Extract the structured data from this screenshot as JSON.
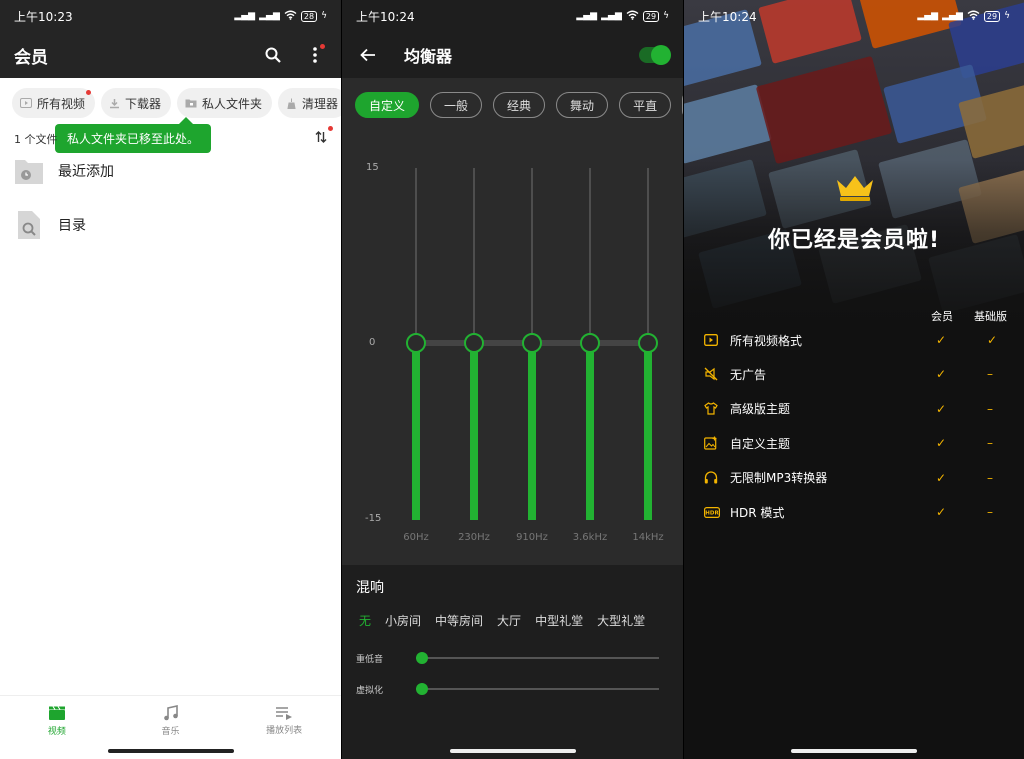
{
  "left": {
    "status": {
      "time": "上午10:23",
      "battery": "28"
    },
    "title": "会员",
    "chips": [
      "所有视频",
      "下载器",
      "私人文件夹",
      "清理器"
    ],
    "tooltip": "私人文件夹已移至此处。",
    "file_count": "1 个文件",
    "rows": [
      "最近添加",
      "目录"
    ],
    "nav": [
      "视频",
      "音乐",
      "播放列表"
    ],
    "accent": "#1ea52e"
  },
  "middle": {
    "status": {
      "time": "上午10:24",
      "battery": "29"
    },
    "title": "均衡器",
    "toggle_on": true,
    "presets": [
      "自定义",
      "一般",
      "经典",
      "舞动",
      "平直"
    ],
    "y_ticks": [
      "15",
      "0",
      "-15"
    ],
    "chart_data": {
      "type": "bar",
      "categories": [
        "60Hz",
        "230Hz",
        "910Hz",
        "3.6kHz",
        "14kHz"
      ],
      "values": [
        0,
        0,
        0,
        0,
        0
      ],
      "ylim": [
        -15,
        15
      ]
    },
    "reverb": {
      "title": "混响",
      "options": [
        "无",
        "小房间",
        "中等房间",
        "大厅",
        "中型礼堂",
        "大型礼堂"
      ],
      "selected": "无",
      "sliders": [
        {
          "label": "重低音",
          "value": 0
        },
        {
          "label": "虚拟化",
          "value": 0
        }
      ]
    },
    "accent": "#22b232"
  },
  "right": {
    "status": {
      "time": "上午10:24",
      "battery": "29"
    },
    "title": "你已经是会员啦!",
    "col_member": "会员",
    "col_basic": "基础版",
    "features": [
      {
        "icon": "video-format-icon",
        "name": "所有视频格式",
        "member": "✓",
        "basic": "✓"
      },
      {
        "icon": "no-ads-icon",
        "name": "无广告",
        "member": "✓",
        "basic": "–"
      },
      {
        "icon": "shirt-icon",
        "name": "高级版主题",
        "member": "✓",
        "basic": "–"
      },
      {
        "icon": "image-edit-icon",
        "name": "自定义主题",
        "member": "✓",
        "basic": "–"
      },
      {
        "icon": "headphones-icon",
        "name": "无限制MP3转换器",
        "member": "✓",
        "basic": "–"
      },
      {
        "icon": "hdr-icon",
        "name": "HDR 模式",
        "member": "✓",
        "basic": "–"
      }
    ],
    "accent": "#f3b400"
  }
}
